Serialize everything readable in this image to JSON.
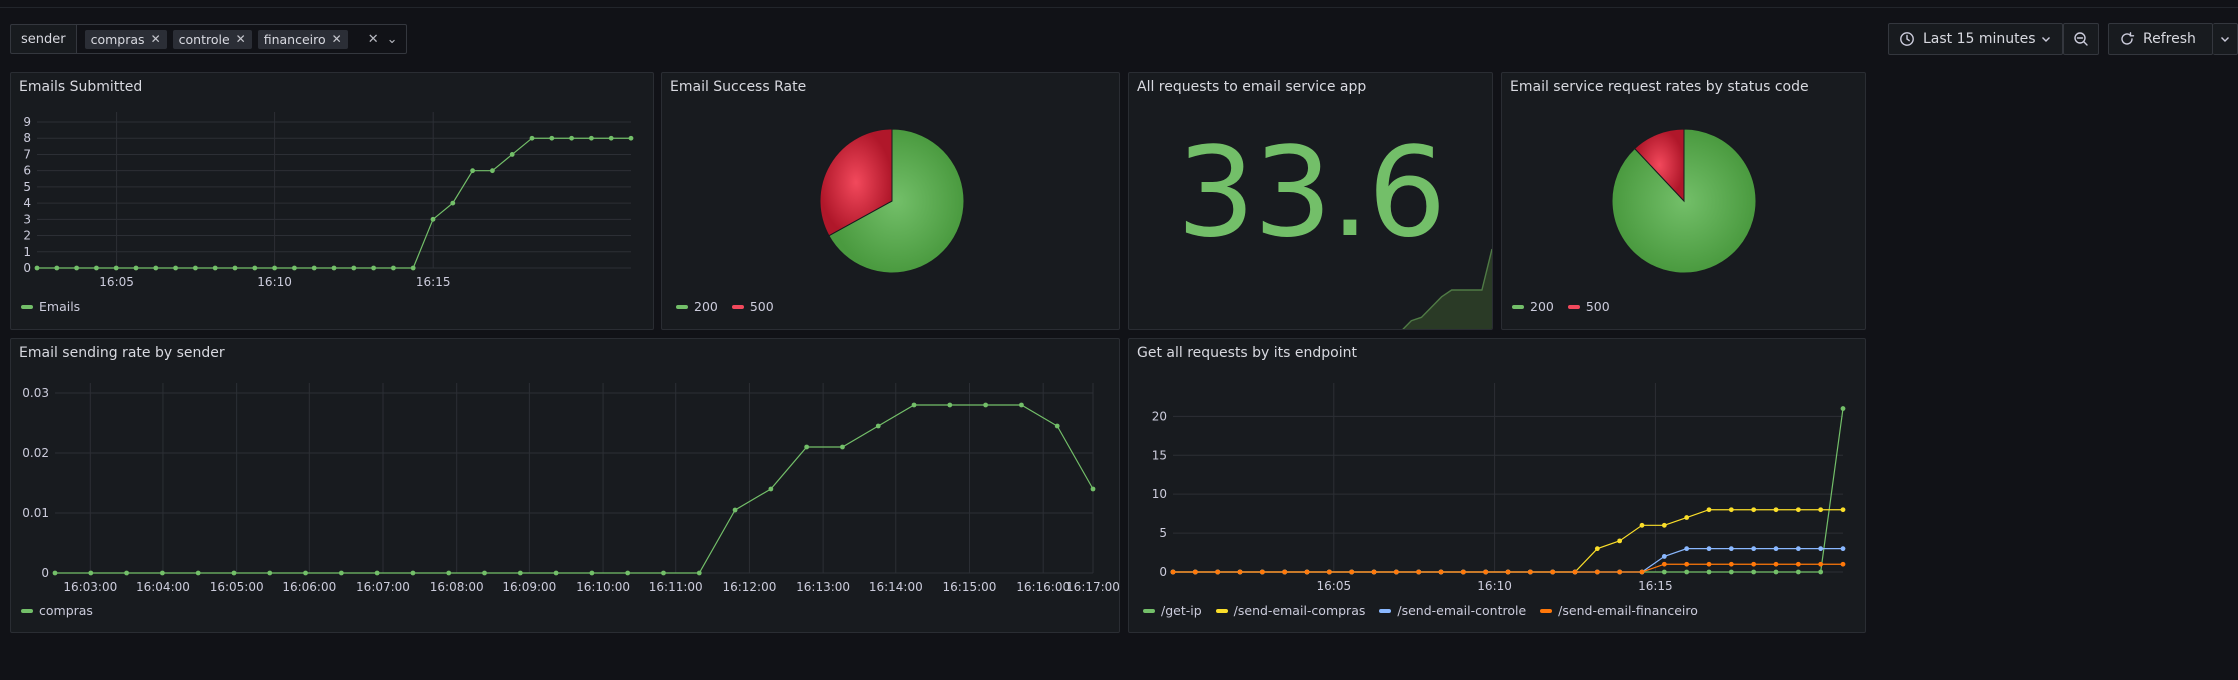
{
  "variables": {
    "label": "sender",
    "chips": [
      "compras",
      "controle",
      "financeiro"
    ]
  },
  "toolbar": {
    "time_range": "Last 15 minutes",
    "refresh_label": "Refresh"
  },
  "colors": {
    "green": "#73bf69",
    "red": "#f2495c",
    "yellow": "#fade2a",
    "blue": "#8ab8ff",
    "orange": "#ff780a",
    "panel_bg": "#181b1f",
    "page_bg": "#111217"
  },
  "icons": [
    "close-icon",
    "chevron-down-icon",
    "clock-icon",
    "zoom-out-icon",
    "refresh-icon"
  ],
  "panels": {
    "emails_submitted": {
      "title": "Emails Submitted",
      "legend": [
        "Emails"
      ]
    },
    "email_success_rate": {
      "title": "Email Success Rate",
      "legend": [
        "200",
        "500"
      ]
    },
    "all_requests": {
      "title": "All requests to email service app",
      "value": "33.6"
    },
    "status_code_rates": {
      "title": "Email service request rates by status code",
      "legend": [
        "200",
        "500"
      ]
    },
    "sending_rate": {
      "title": "Email sending rate by sender",
      "legend": [
        "compras"
      ]
    },
    "endpoint_requests": {
      "title": "Get all requests by its endpoint",
      "legend": [
        "/get-ip",
        "/send-email-compras",
        "/send-email-controle",
        "/send-email-financeiro"
      ]
    }
  },
  "chart_data": [
    {
      "type": "line",
      "title": "Emails Submitted",
      "x_ticks": [
        "16:05",
        "16:10",
        "16:15"
      ],
      "y_ticks": [
        0,
        1,
        2,
        3,
        4,
        5,
        6,
        7,
        8,
        9
      ],
      "ylim": [
        0,
        9
      ],
      "series": [
        {
          "name": "Emails",
          "values": [
            0,
            0,
            0,
            0,
            0,
            0,
            0,
            0,
            0,
            0,
            0,
            0,
            0,
            0,
            0,
            0,
            0,
            0,
            0,
            0,
            3,
            4,
            6,
            6,
            7,
            8,
            8,
            8,
            8,
            8,
            8
          ]
        }
      ]
    },
    {
      "type": "pie",
      "title": "Email Success Rate",
      "categories": [
        "200",
        "500"
      ],
      "values": [
        67,
        33
      ]
    },
    {
      "type": "area",
      "title": "All requests to email service app",
      "value": 33.6,
      "values": [
        0,
        0,
        0,
        0,
        0,
        0,
        0,
        0,
        0,
        0,
        0,
        0,
        0,
        0,
        0,
        0,
        0,
        0,
        0,
        0,
        0,
        0,
        0,
        0,
        0,
        0,
        0,
        0,
        1.5,
        2,
        3.5,
        5,
        6,
        6,
        6,
        6,
        12
      ]
    },
    {
      "type": "pie",
      "title": "Email service request rates by status code",
      "categories": [
        "200",
        "500"
      ],
      "values": [
        88,
        12
      ]
    },
    {
      "type": "line",
      "title": "Email sending rate by sender",
      "x_ticks": [
        "16:03:00",
        "16:04:00",
        "16:05:00",
        "16:06:00",
        "16:07:00",
        "16:08:00",
        "16:09:00",
        "16:10:00",
        "16:11:00",
        "16:12:00",
        "16:13:00",
        "16:14:00",
        "16:15:00",
        "16:16:00",
        "16:17:00"
      ],
      "y_ticks": [
        "0",
        "0.01",
        "0.02",
        "0.03"
      ],
      "ylim": [
        0,
        0.03
      ],
      "series": [
        {
          "name": "compras",
          "values": [
            0,
            0,
            0,
            0,
            0,
            0,
            0,
            0,
            0,
            0,
            0,
            0,
            0,
            0,
            0,
            0,
            0,
            0,
            0,
            0.0105,
            0.014,
            0.021,
            0.021,
            0.0245,
            0.028,
            0.028,
            0.028,
            0.028,
            0.0245,
            0.014
          ]
        }
      ]
    },
    {
      "type": "line",
      "title": "Get all requests by its endpoint",
      "x_ticks": [
        "16:05",
        "16:10",
        "16:15"
      ],
      "y_ticks": [
        0,
        5,
        10,
        15,
        20
      ],
      "ylim": [
        0,
        23
      ],
      "series": [
        {
          "name": "/get-ip",
          "values": [
            0,
            0,
            0,
            0,
            0,
            0,
            0,
            0,
            0,
            0,
            0,
            0,
            0,
            0,
            0,
            0,
            0,
            0,
            0,
            0,
            0,
            0,
            0,
            0,
            0,
            0,
            0,
            0,
            0,
            0,
            21
          ]
        },
        {
          "name": "/send-email-compras",
          "values": [
            0,
            0,
            0,
            0,
            0,
            0,
            0,
            0,
            0,
            0,
            0,
            0,
            0,
            0,
            0,
            0,
            0,
            0,
            0,
            3,
            4,
            6,
            6,
            7,
            8,
            8,
            8,
            8,
            8,
            8,
            8
          ]
        },
        {
          "name": "/send-email-controle",
          "values": [
            0,
            0,
            0,
            0,
            0,
            0,
            0,
            0,
            0,
            0,
            0,
            0,
            0,
            0,
            0,
            0,
            0,
            0,
            0,
            0,
            0,
            0,
            2,
            3,
            3,
            3,
            3,
            3,
            3,
            3,
            3
          ]
        },
        {
          "name": "/send-email-financeiro",
          "values": [
            0,
            0,
            0,
            0,
            0,
            0,
            0,
            0,
            0,
            0,
            0,
            0,
            0,
            0,
            0,
            0,
            0,
            0,
            0,
            0,
            0,
            0,
            1,
            1,
            1,
            1,
            1,
            1,
            1,
            1,
            1
          ]
        }
      ]
    }
  ]
}
